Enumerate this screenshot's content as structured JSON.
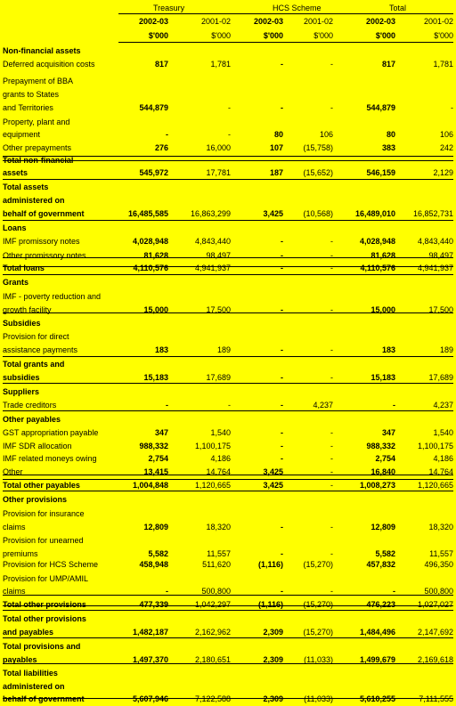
{
  "header": {
    "groups": [
      "Treasury",
      "HCS Scheme",
      "Total"
    ],
    "years": [
      "2002-03",
      "2001-02",
      "2002-03",
      "2001-02",
      "2002-03",
      "2001-02"
    ],
    "units": [
      "$'000",
      "$'000",
      "$'000",
      "$'000",
      "$'000",
      "$'000"
    ]
  },
  "rows": [
    {
      "label": "Non-financial assets",
      "bold": true,
      "values": [
        "",
        "",
        "",
        "",
        "",
        ""
      ]
    },
    {
      "label": "Deferred acquisition costs",
      "values": [
        "817",
        "1,781",
        "-",
        "-",
        "817",
        "1,781"
      ]
    },
    {
      "label": "Prepayment of BBA",
      "values": [
        "",
        "",
        "",
        "",
        "",
        ""
      ]
    },
    {
      "label": "grants to States",
      "values": [
        "",
        "",
        "",
        "",
        "",
        ""
      ]
    },
    {
      "label": "and Territories",
      "values": [
        "544,879",
        "-",
        "-",
        "-",
        "544,879",
        "-"
      ]
    },
    {
      "label": "Property, plant and",
      "values": [
        "",
        "",
        "",
        "",
        "",
        ""
      ]
    },
    {
      "label": "equipment",
      "values": [
        "-",
        "-",
        "80",
        "106",
        "80",
        "106"
      ]
    },
    {
      "label": "Other prepayments",
      "values": [
        "276",
        "16,000",
        "107",
        "(15,758)",
        "383",
        "242"
      ]
    },
    {
      "label": "Total non-financial",
      "bold": true,
      "values": [
        "",
        "",
        "",
        "",
        "",
        ""
      ]
    },
    {
      "label": " assets",
      "bold": true,
      "values": [
        "545,972",
        "17,781",
        "187",
        "(15,652)",
        "546,159",
        "2,129"
      ]
    },
    {
      "label": "Total assets",
      "bold": true,
      "values": [
        "",
        "",
        "",
        "",
        "",
        ""
      ]
    },
    {
      "label": " administered on",
      "bold": true,
      "values": [
        "",
        "",
        "",
        "",
        "",
        ""
      ]
    },
    {
      "label": " behalf of government",
      "bold": true,
      "values": [
        "16,485,585",
        "16,863,299",
        "3,425",
        "(10,568)",
        "16,489,010",
        "16,852,731"
      ]
    },
    {
      "label": "Loans",
      "bold": true,
      "values": [
        "",
        "",
        "",
        "",
        "",
        ""
      ]
    },
    {
      "label": "IMF promissory notes",
      "values": [
        "4,028,948",
        "4,843,440",
        "-",
        "-",
        "4,028,948",
        "4,843,440"
      ]
    },
    {
      "label": "Other promissory notes",
      "values": [
        "81,628",
        "98,497",
        "-",
        "-",
        "81,628",
        "98,497"
      ]
    },
    {
      "label": "Total loans",
      "bold": true,
      "values": [
        "4,110,576",
        "4,941,937",
        "-",
        "-",
        "4,110,576",
        "4,941,937"
      ]
    },
    {
      "label": "Grants",
      "bold": true,
      "values": [
        "",
        "",
        "",
        "",
        "",
        ""
      ]
    },
    {
      "label": "IMF - poverty reduction and",
      "values": [
        "",
        "",
        "",
        "",
        "",
        ""
      ]
    },
    {
      "label": "growth facility",
      "values": [
        "15,000",
        "17,500",
        "-",
        "-",
        "15,000",
        "17,500"
      ]
    },
    {
      "label": "Subsidies",
      "bold": true,
      "values": [
        "",
        "",
        "",
        "",
        "",
        ""
      ]
    },
    {
      "label": "Provision for direct",
      "values": [
        "",
        "",
        "",
        "",
        "",
        ""
      ]
    },
    {
      "label": " assistance payments",
      "values": [
        "183",
        "189",
        "-",
        "-",
        "183",
        "189"
      ]
    },
    {
      "label": "Total grants and",
      "bold": true,
      "values": [
        "",
        "",
        "",
        "",
        "",
        ""
      ]
    },
    {
      "label": " subsidies",
      "bold": true,
      "values": [
        "15,183",
        "17,689",
        "-",
        "-",
        "15,183",
        "17,689"
      ]
    },
    {
      "label": "Suppliers",
      "bold": true,
      "values": [
        "",
        "",
        "",
        "",
        "",
        ""
      ]
    },
    {
      "label": "Trade creditors",
      "values": [
        "-",
        "-",
        "-",
        "4,237",
        "-",
        "4,237"
      ]
    },
    {
      "label": "Other payables",
      "bold": true,
      "values": [
        "",
        "",
        "",
        "",
        "",
        ""
      ]
    },
    {
      "label": "GST appropriation payable",
      "values": [
        "347",
        "1,540",
        "-",
        "-",
        "347",
        "1,540"
      ]
    },
    {
      "label": "IMF SDR allocation",
      "values": [
        "988,332",
        "1,100,175",
        "-",
        "-",
        "988,332",
        "1,100,175"
      ]
    },
    {
      "label": "IMF related moneys owing",
      "values": [
        "2,754",
        "4,186",
        "-",
        "-",
        "2,754",
        "4,186"
      ]
    },
    {
      "label": "Other",
      "values": [
        "13,415",
        "14,764",
        "3,425",
        "-",
        "16,840",
        "14,764"
      ]
    },
    {
      "label": "Total other payables",
      "bold": true,
      "values": [
        "1,004,848",
        "1,120,665",
        "3,425",
        "-",
        "1,008,273",
        "1,120,665"
      ]
    },
    {
      "label": "Other provisions",
      "bold": true,
      "values": [
        "",
        "",
        "",
        "",
        "",
        ""
      ]
    },
    {
      "label": "Provision for insurance",
      "values": [
        "",
        "",
        "",
        "",
        "",
        ""
      ]
    },
    {
      "label": " claims",
      "values": [
        "12,809",
        "18,320",
        "-",
        "-",
        "12,809",
        "18,320"
      ]
    },
    {
      "label": "Provision for unearned",
      "values": [
        "",
        "",
        "",
        "",
        "",
        ""
      ]
    },
    {
      "label": " premiums",
      "values": [
        "5,582",
        "11,557",
        "-",
        "-",
        "5,582",
        "11,557"
      ]
    },
    {
      "label": "Provision for HCS Scheme",
      "values": [
        "458,948",
        "511,620",
        "(1,116)",
        "(15,270)",
        "457,832",
        "496,350"
      ]
    },
    {
      "label": "Provision for UMP/AMIL",
      "values": [
        "",
        "",
        "",
        "",
        "",
        ""
      ]
    },
    {
      "label": "claims",
      "values": [
        "-",
        "500,800",
        "-",
        "-",
        "-",
        "500,800"
      ]
    },
    {
      "label": "Total other provisions",
      "bold": true,
      "values": [
        "477,339",
        "1,042,297",
        "(1,116)",
        "(15,270)",
        "476,223",
        "1,027,027"
      ]
    },
    {
      "label": "Total other provisions",
      "bold": true,
      "values": [
        "",
        "",
        "",
        "",
        "",
        ""
      ]
    },
    {
      "label": " and payables",
      "bold": true,
      "values": [
        "1,482,187",
        "2,162,962",
        "2,309",
        "(15,270)",
        "1,484,496",
        "2,147,692"
      ]
    },
    {
      "label": "Total provisions and",
      "bold": true,
      "values": [
        "",
        "",
        "",
        "",
        "",
        ""
      ]
    },
    {
      "label": " payables",
      "bold": true,
      "values": [
        "1,497,370",
        "2,180,651",
        "2,309",
        "(11,033)",
        "1,499,679",
        "2,169,618"
      ]
    },
    {
      "label": "Total liabilities",
      "bold": true,
      "values": [
        "",
        "",
        "",
        "",
        "",
        ""
      ]
    },
    {
      "label": " administered on",
      "bold": true,
      "values": [
        "",
        "",
        "",
        "",
        "",
        ""
      ]
    },
    {
      "label": " behalf of government",
      "bold": true,
      "values": [
        "5,607,946",
        "7,122,588",
        "2,309",
        "(11,033)",
        "5,610,255",
        "7,111,555"
      ]
    }
  ]
}
